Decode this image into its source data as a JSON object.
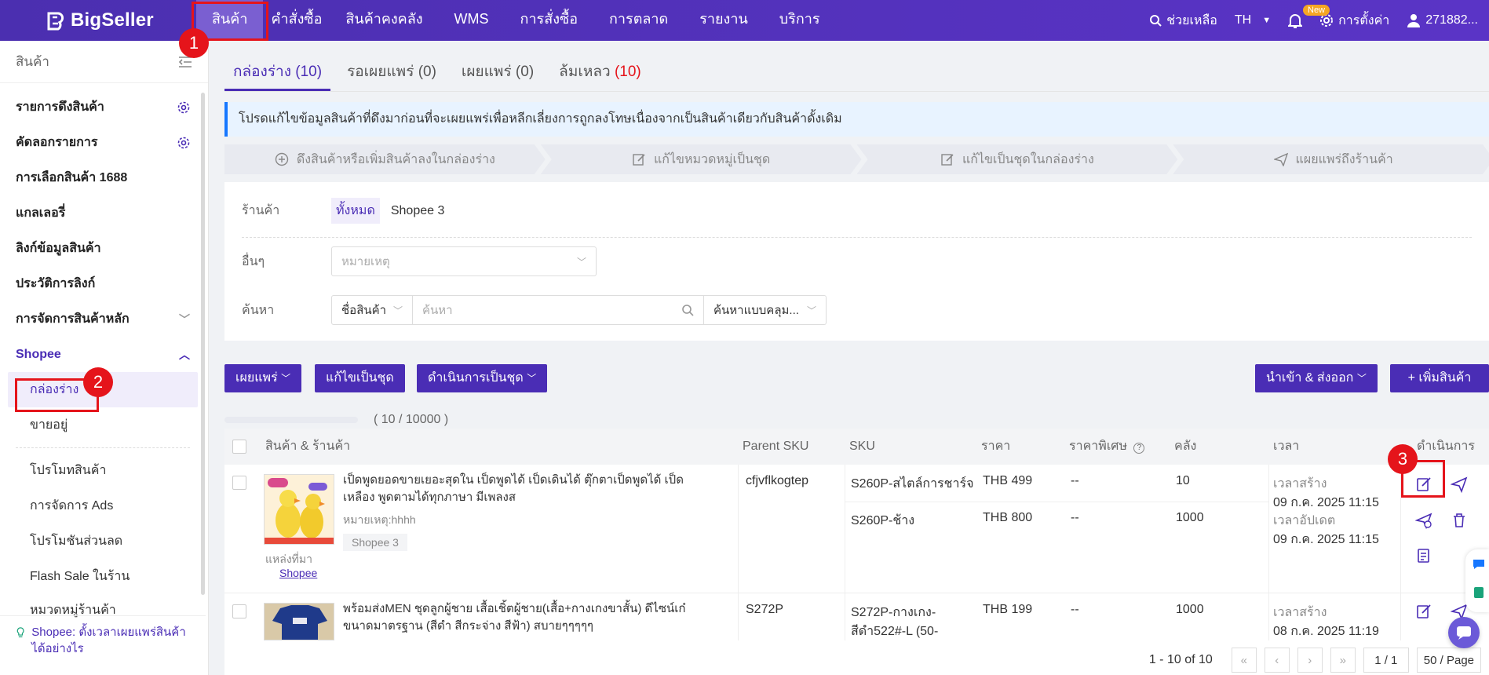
{
  "brand": {
    "name": "BigSeller"
  },
  "topnav": {
    "menu": [
      "สินค้า",
      "คำสั่งซื้อ",
      "สินค้าคงคลัง",
      "WMS",
      "การสั่งซื้อ",
      "การตลาด",
      "รายงาน",
      "บริการ"
    ],
    "help": "ช่วยเหลือ",
    "lang": "TH",
    "new_badge": "New",
    "settings": "การตั้งค่า",
    "user": "271882..."
  },
  "annotations": {
    "one": "1",
    "two": "2",
    "three": "3"
  },
  "sidebar": {
    "title": "สินค้า",
    "items": {
      "pull": "รายการดึงสินค้า",
      "copy": "คัดลอกรายการ",
      "select1688": "การเลือกสินค้า 1688",
      "gallery": "แกลเลอรี่",
      "link": "ลิงก์ข้อมูลสินค้า",
      "history": "ประวัติการลิงก์",
      "master": "การจัดการสินค้าหลัก",
      "shopee": "Shopee",
      "drafts": "กล่องร่าง",
      "selling": "ขายอยู่",
      "promo": "โปรโมทสินค้า",
      "ads": "การจัดการ Ads",
      "discount": "โปรโมชันส่วนลด",
      "flash": "Flash Sale ในร้าน",
      "category": "หมวดหมู่ร้านค้า"
    },
    "footer": "Shopee: ตั้งเวลาเผยแพร่สินค้าได้อย่างไร"
  },
  "tabs": {
    "draft": "กล่องร่าง (10)",
    "pending": "รอเผยแพร่ (0)",
    "published_label": "เผยแพร่ (0)",
    "failed_label": "ล้มเหลว",
    "failed_count": "(10)"
  },
  "notice": "โปรดแก้ไขข้อมูลสินค้าที่ดึงมาก่อนที่จะเผยแพร่เพื่อหลีกเลี่ยงการถูกลงโทษเนื่องจากเป็นสินค้าเดียวกับสินค้าดั้งเดิม",
  "steps": [
    "ดึงสินค้าหรือเพิ่มสินค้าลงในกล่องร่าง",
    "แก้ไขหมวดหมู่เป็นชุด",
    "แก้ไขเป็นชุดในกล่องร่าง",
    "แผยแพร่ถึงร้านค้า"
  ],
  "filters": {
    "store_label": "ร้านค้า",
    "store_all": "ทั้งหมด",
    "store_name": "Shopee 3",
    "other_label": "อื่นๆ",
    "note_placeholder": "หมายเหตุ",
    "search_label": "ค้นหา",
    "search_field": "ชื่อสินค้า",
    "search_placeholder": "ค้นหา",
    "search_mode": "ค้นหาแบบคลุม..."
  },
  "actions": {
    "publish": "เผยแพร่",
    "batch_edit": "แก้ไขเป็นชุด",
    "batch_ops": "ดำเนินการเป็นชุด",
    "import_export": "นำเข้า & ส่งออก",
    "add_product": "+ เพิ่มสินค้า"
  },
  "progress_text": "( 10 / 10000 )",
  "table": {
    "headers": {
      "product": "สินค้า & ร้านค้า",
      "parent_sku": "Parent SKU",
      "sku": "SKU",
      "price": "ราคา",
      "special_price": "ราคาพิเศษ",
      "stock": "คลัง",
      "time": "เวลา",
      "ops": "ดำเนินการ"
    },
    "rows": [
      {
        "name": "เป็ดพูดยอดขายเยอะสุดใน เป็ดพูดได้ เป็ดเดินได้ ตุ๊กตาเป็ดพูดได้ เป็ดเหลือง พูดตามได้ทุกภาษา มีเพลงส",
        "note": "หมายเหตุ:hhhh",
        "store": "Shopee 3",
        "source_label": "แหล่งที่มา",
        "source": "Shopee",
        "parent_sku": "cfjvflkogtep",
        "variants": [
          {
            "sku": "S260P-สไตล์การชาร์จ",
            "price": "THB 499",
            "special": "--",
            "stock": "10"
          },
          {
            "sku": "S260P-ช้าง",
            "price": "THB 800",
            "special": "--",
            "stock": "1000"
          }
        ],
        "created_label": "เวลาสร้าง",
        "created": "09 ก.ค. 2025 11:15",
        "updated_label": "เวลาอัปเดต",
        "updated": "09 ก.ค. 2025 11:15"
      },
      {
        "name": "พร้อมส่งMEN ชุดลูกผู้ชาย เสื้อเชิ้ตผู้ชาย(เสื้อ+กางเกงขาสั้น) ดีไซน์เก๋ ขนาดมาตรฐาน (สีดำ สีกระจ่าง สีฟ้า) สบายๆๆๆๆๆ",
        "parent_sku": "S272P",
        "sku_line1": "S272P-กางเกง-",
        "sku_line2": "สีดำ522#-L (50-",
        "price": "THB 199",
        "special": "--",
        "stock": "1000",
        "created_label": "เวลาสร้าง",
        "created": "08 ก.ค. 2025 11:19"
      }
    ]
  },
  "pager": {
    "range": "1 - 10 of 10",
    "page": "1 / 1",
    "per_page": "50 / Page"
  },
  "colors": {
    "brand": "#4a2db5",
    "annotation": "#e5141b",
    "notice_border": "#1677ff"
  }
}
